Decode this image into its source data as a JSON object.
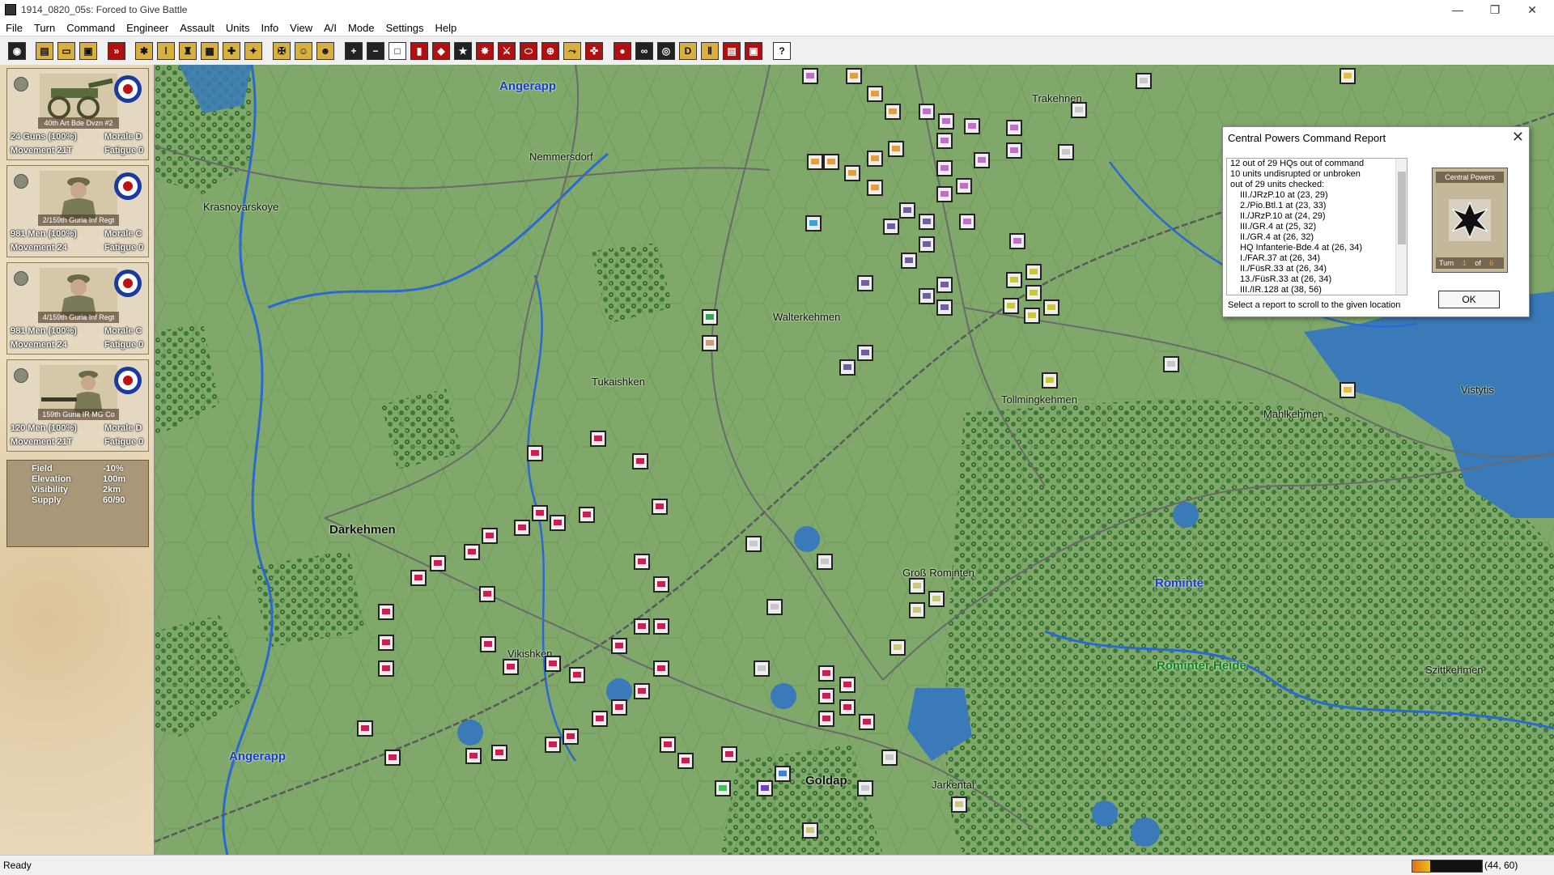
{
  "window": {
    "title": "1914_0820_05s: Forced to Give Battle",
    "minimize": "—",
    "restore": "❐",
    "close": "✕"
  },
  "menu": [
    "File",
    "Turn",
    "Command",
    "Engineer",
    "Assault",
    "Units",
    "Info",
    "View",
    "A/I",
    "Mode",
    "Settings",
    "Help"
  ],
  "units": [
    {
      "name": "40th Art Bde Dvzn #2",
      "strength": "24 Guns (100%)",
      "morale": "Morale D",
      "movement": "Movement 21T",
      "fatigue": "Fatigue 0",
      "type": "artillery"
    },
    {
      "name": "2/159th Guria Inf Regt",
      "strength": "981 Men (100%)",
      "morale": "Morale C",
      "movement": "Movement 24",
      "fatigue": "Fatigue 0",
      "type": "infantry"
    },
    {
      "name": "4/159th Guria Inf Regt",
      "strength": "981 Men (100%)",
      "morale": "Morale C",
      "movement": "Movement 24",
      "fatigue": "Fatigue 0",
      "type": "infantry"
    },
    {
      "name": "159th Guria IR MG Co",
      "strength": "120 Men (100%)",
      "morale": "Morale D",
      "movement": "Movement 21T",
      "fatigue": "Fatigue 0",
      "type": "machinegun"
    }
  ],
  "terrain": [
    {
      "label": "Field",
      "value": "-10%"
    },
    {
      "label": "Elevation",
      "value": "100m"
    },
    {
      "label": "Visibility",
      "value": "2km"
    },
    {
      "label": "Supply",
      "value": "60/90"
    }
  ],
  "map_labels": [
    {
      "text": "Angerapp",
      "style": "blue"
    },
    {
      "text": "Nemmersdorf",
      "style": "normal"
    },
    {
      "text": "Krasnoyarskoye",
      "style": "normal"
    },
    {
      "text": "Trakehnen",
      "style": "normal"
    },
    {
      "text": "Walterkehmen",
      "style": "normal"
    },
    {
      "text": "Tukaishken",
      "style": "normal"
    },
    {
      "text": "Tollmingkehmen",
      "style": "normal"
    },
    {
      "text": "Mahlkehmen",
      "style": "normal"
    },
    {
      "text": "Vistytis",
      "style": "normal"
    },
    {
      "text": "Darkehmen",
      "style": "big"
    },
    {
      "text": "Groß Rominten",
      "style": "normal"
    },
    {
      "text": "Rominte",
      "style": "blue"
    },
    {
      "text": "Rominter Heide",
      "style": "green"
    },
    {
      "text": "Szittkehmen",
      "style": "normal"
    },
    {
      "text": "Vikishken",
      "style": "normal"
    },
    {
      "text": "Angerapp",
      "style": "blue"
    },
    {
      "text": "Goldap",
      "style": "big"
    },
    {
      "text": "Jarkental",
      "style": "normal"
    }
  ],
  "dialog": {
    "title": "Central Powers Command Report",
    "close": "✕",
    "lines": [
      "12 out of 29 HQs out of command",
      "10 units undisrupted or unbroken",
      "out of 29 units checked:",
      "III./JRzP.10 at (23, 29)",
      "2./Pio.Btl.1 at (23, 33)",
      "II./JRzP.10 at (24, 29)",
      "III./GR.4 at (25, 32)",
      "II./GR.4 at (26, 32)",
      "HQ Infanterie-Bde.4 at (26, 34)",
      "I./FAR.37 at (26, 34)",
      "II./FüsR.33 at (26, 34)",
      "13./FüsR.33 at (26, 34)",
      "III./IR.128 at (38, 56)"
    ],
    "hint": "Select a report to scroll to the given location",
    "side_label": "Central Powers",
    "turn_label": "Turn",
    "turn_current": "1",
    "turn_of": "of",
    "turn_total": "6",
    "ok_label": "OK"
  },
  "status": {
    "text": "Ready",
    "coords": "(44, 60)",
    "meter_fraction": 0.25
  },
  "colors": {
    "map_grass": "#7fa86a",
    "forest": "#3f7a3a",
    "water": "#3a7ab8",
    "road": "#6a6a6a",
    "german_counter": "#ece4cc",
    "russian_counter": "#c82050",
    "accent_purple": "#c070c8"
  }
}
